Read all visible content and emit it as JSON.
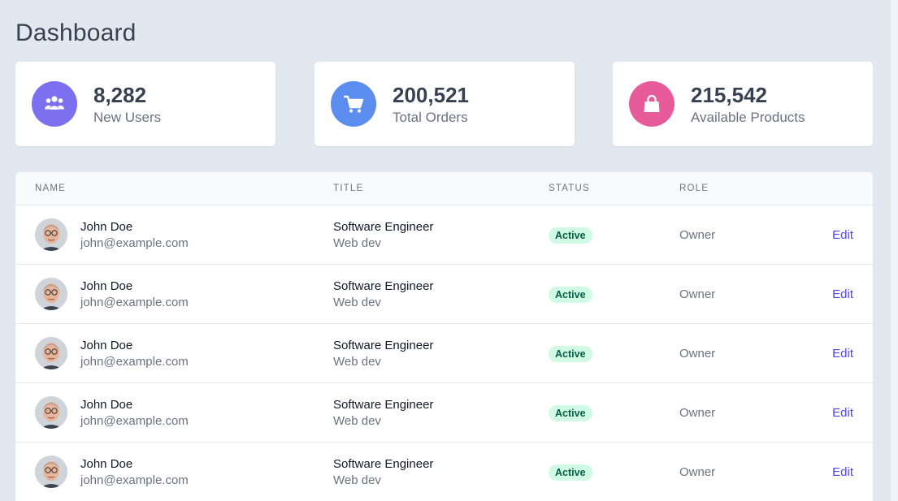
{
  "header": {
    "title": "Dashboard"
  },
  "stats": [
    {
      "value": "8,282",
      "label": "New Users",
      "icon": "users-icon",
      "color": "#7c6ff0"
    },
    {
      "value": "200,521",
      "label": "Total Orders",
      "icon": "cart-icon",
      "color": "#5b8def"
    },
    {
      "value": "215,542",
      "label": "Available Products",
      "icon": "shopping-bag-icon",
      "color": "#e85b9a"
    }
  ],
  "table": {
    "columns": {
      "name": "NAME",
      "title": "TITLE",
      "status": "STATUS",
      "role": "ROLE"
    },
    "rows": [
      {
        "name": "John Doe",
        "email": "john@example.com",
        "title": "Software Engineer",
        "dept": "Web dev",
        "status": "Active",
        "role": "Owner",
        "action": "Edit"
      },
      {
        "name": "John Doe",
        "email": "john@example.com",
        "title": "Software Engineer",
        "dept": "Web dev",
        "status": "Active",
        "role": "Owner",
        "action": "Edit"
      },
      {
        "name": "John Doe",
        "email": "john@example.com",
        "title": "Software Engineer",
        "dept": "Web dev",
        "status": "Active",
        "role": "Owner",
        "action": "Edit"
      },
      {
        "name": "John Doe",
        "email": "john@example.com",
        "title": "Software Engineer",
        "dept": "Web dev",
        "status": "Active",
        "role": "Owner",
        "action": "Edit"
      },
      {
        "name": "John Doe",
        "email": "john@example.com",
        "title": "Software Engineer",
        "dept": "Web dev",
        "status": "Active",
        "role": "Owner",
        "action": "Edit"
      }
    ]
  },
  "colors": {
    "status_active_bg": "#d1fae5",
    "status_active_text": "#065f46",
    "link": "#4f46e5"
  }
}
